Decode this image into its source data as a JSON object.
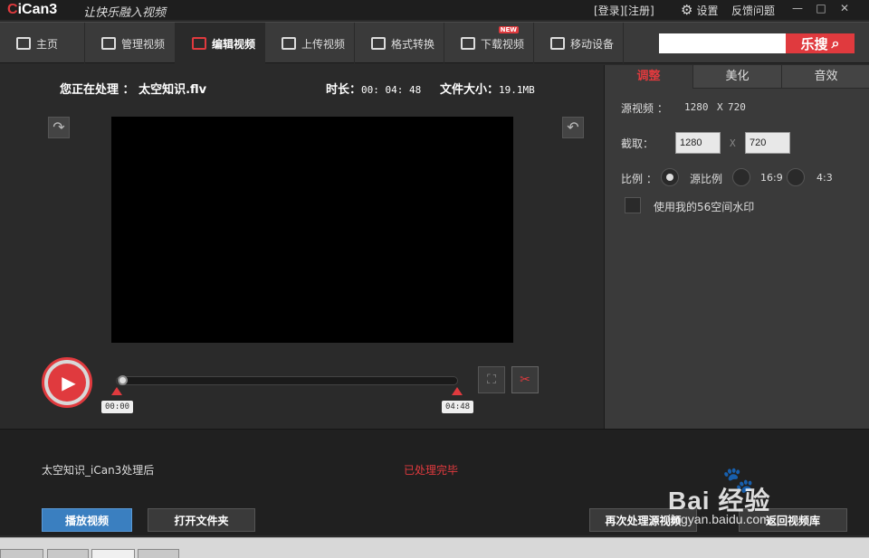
{
  "titlebar": {
    "logo": "iCan3",
    "slogan": "让快乐融入视频",
    "login": "[登录][注册]",
    "settings": "设置",
    "feedback": "反馈问题",
    "window_buttons": [
      "—",
      "□",
      "✕"
    ]
  },
  "nav": {
    "items": [
      {
        "label": "主页",
        "icon": "home-icon"
      },
      {
        "label": "管理视频",
        "icon": "manage-video-icon"
      },
      {
        "label": "编辑视频",
        "icon": "edit-video-icon",
        "active": true
      },
      {
        "label": "上传视频",
        "icon": "upload-icon"
      },
      {
        "label": "格式转换",
        "icon": "convert-icon"
      },
      {
        "label": "下载视频",
        "icon": "download-icon",
        "badge": "NEW"
      },
      {
        "label": "移动设备",
        "icon": "mobile-icon"
      }
    ],
    "search_placeholder": "",
    "search_button": "乐搜"
  },
  "editor": {
    "processing_label": "您正在处理 ：",
    "filename": "太空知识.flv",
    "duration_label": "时长：",
    "duration_value": "00: 04: 48",
    "filesize_label": "文件大小：",
    "filesize_value": "19.1MB",
    "start_time": "00:00",
    "end_time": "04:48"
  },
  "panel": {
    "tabs": [
      "调整",
      "美化",
      "音效"
    ],
    "source_label": "源视频 ：",
    "source_w": "1280",
    "source_x": "X",
    "source_h": "720",
    "crop_label": "截取：",
    "crop_w": "1280",
    "crop_x": "X",
    "crop_h": "720",
    "ratio_label": "比例 ：",
    "ratio_options": [
      "源比例",
      "16:9",
      "4:3"
    ],
    "ratio_selected": "源比例",
    "watermark_label": "使用我的56空间水印"
  },
  "output": {
    "filename": "太空知识_iCan3处理后",
    "status": "已处理完毕",
    "buttons": {
      "play": "播放视频",
      "open_folder": "打开文件夹",
      "reprocess": "再次处理源视频",
      "back": "返回视频库"
    }
  },
  "watermark": {
    "logo": "Bai  经验",
    "url": "jingyan.baidu.com"
  },
  "colors": {
    "accent": "#e03a3e",
    "primary_button": "#3a7fc0",
    "panel_bg": "#3a3a3a",
    "main_bg": "#2a2a2a"
  }
}
